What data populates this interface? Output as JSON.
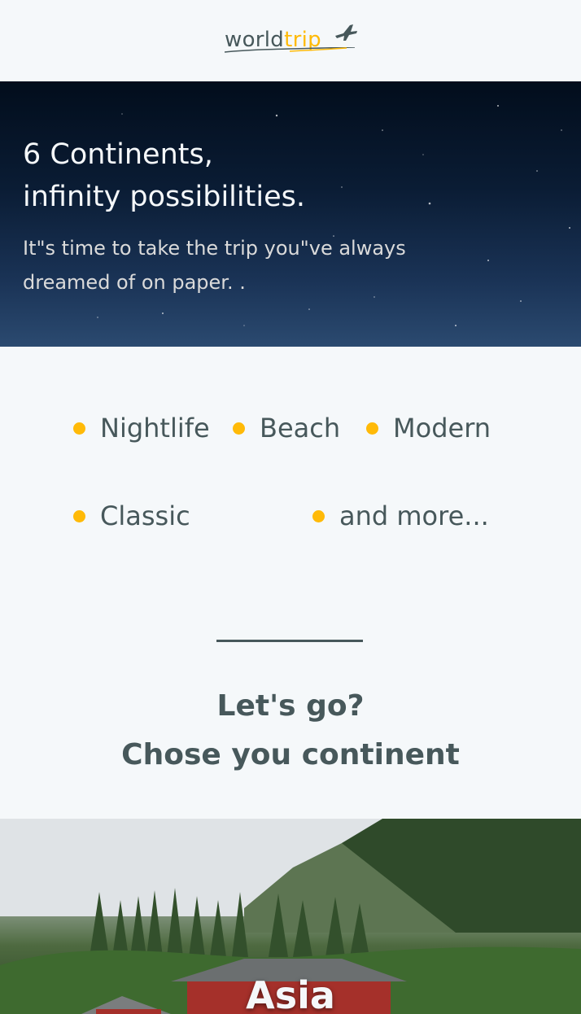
{
  "header": {
    "logo_part1": "world",
    "logo_part2": "trip"
  },
  "banner": {
    "title_line1": "6 Continents,",
    "title_line2": "infinity possibilities.",
    "subtitle": "It\"s time to take the trip you\"ve always dreamed of on paper. ."
  },
  "categories": [
    {
      "label": "Nightlife"
    },
    {
      "label": "Beach"
    },
    {
      "label": "Modern"
    },
    {
      "label": "Classic"
    },
    {
      "label": "and more..."
    }
  ],
  "cta": {
    "line1": "Let's go?",
    "line2": "Chose you continent"
  },
  "slider": {
    "current_title": "Asia"
  },
  "colors": {
    "accent": "#FFBA08",
    "text_dark": "#47585B",
    "background": "#F5F8FA"
  },
  "icons": {
    "logo_plane": "airplane-icon",
    "category_bullet": "dot-icon"
  }
}
